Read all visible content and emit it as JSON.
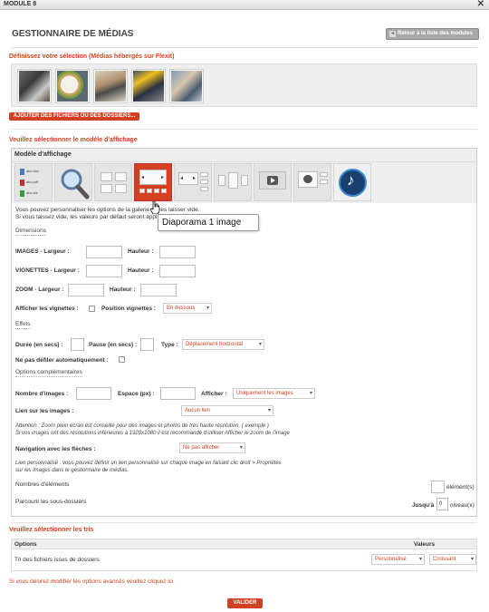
{
  "window": {
    "title": "MODULE 8"
  },
  "header": {
    "title": "GESTIONNAIRE DE MÉDIAS",
    "back_label": "Retour à la liste des modules"
  },
  "selection": {
    "title": "Définissez votre sélection (Médias hébergés sur Flexit)",
    "add_label": "AJOUTER DES FICHIERS OU DES DOSSIERS..."
  },
  "display_model": {
    "section_title": "Veuillez sélectionner le modèle d'affichage",
    "panel_title": "Modèle d'affichage",
    "tooltip": "Diaporama 1 image",
    "doc_labels": [
      "abc.doc",
      "abc.pdf",
      "abc.xls"
    ],
    "help_line1": "Vous pouvez personnaliser les options de la galerie ou les laisser vide.",
    "help_line2": "Si vous laissez vide, les valeurs par défaut seront appliquées."
  },
  "dimensions": {
    "title": "Dimensions",
    "image_width": "IMAGES - Largeur :",
    "image_height": "Hauteur :",
    "thumb_width": "VIGNETTES - Largeur :",
    "thumb_height": "Hauteur :",
    "zoom_width": "ZOOM - Largeur :",
    "zoom_height": "Hauteur :",
    "show_thumbs": "Afficher les vignettes :",
    "thumb_position": "Position vignettes :",
    "thumb_position_value": "En dessous"
  },
  "effects": {
    "title": "Effets",
    "duration": "Durée (en secs) :",
    "pause": "Pause (en secs) :",
    "type": "Type :",
    "type_value": "Déplacement horizontal",
    "no_autoscroll": "Ne pas défiler automatiquement :"
  },
  "options": {
    "title": "Options complémentaires",
    "nb_images": "Nombre d'images :",
    "spacing": "Espace (px) :",
    "display": "Afficher :",
    "display_value": "Uniquement les images",
    "link": "Lien sur les images :",
    "link_value": "Aucun lien",
    "attention1": "Attention : Zoom plein écran est conseillé pour des images et photos de très haute résolution. ( exemple )",
    "attention2": "Si vos images ont des résolutions inférieures à 1920x1080 il est recommandé d'utiliser Afficher le zoom de l'image",
    "nav": "Navigation avec les flèches :",
    "nav_value": "Ne pas afficher",
    "custom_link1": "Lien personnalisé : vous pouvez définir un lien personnalisé sur chaque image en faisant clic droit > Propriétés",
    "custom_link2": "sur les images dans le gestionnaire de médias.",
    "nb_elements": "Nombres d'éléments",
    "elements_unit": "élément(s)",
    "browse": "Parcourir les sous-dossiers",
    "until": "Jusqu'à",
    "level_value": "0",
    "level_unit": "niveau(x)"
  },
  "sorting": {
    "section_title": "Veuillez sélectionner les tris",
    "col_options": "Options",
    "col_values": "Valeurs",
    "row_label": "Tri des fichiers issus de dossiers",
    "value1": "Personnalisé",
    "value2": "Croissant"
  },
  "footer": {
    "advanced": "Si vous désirez modifier les options avancés veuillez cliquez ici",
    "validate": "VALIDER"
  },
  "colors": {
    "accent": "#d14020",
    "panel_bg": "#eeeeee"
  }
}
